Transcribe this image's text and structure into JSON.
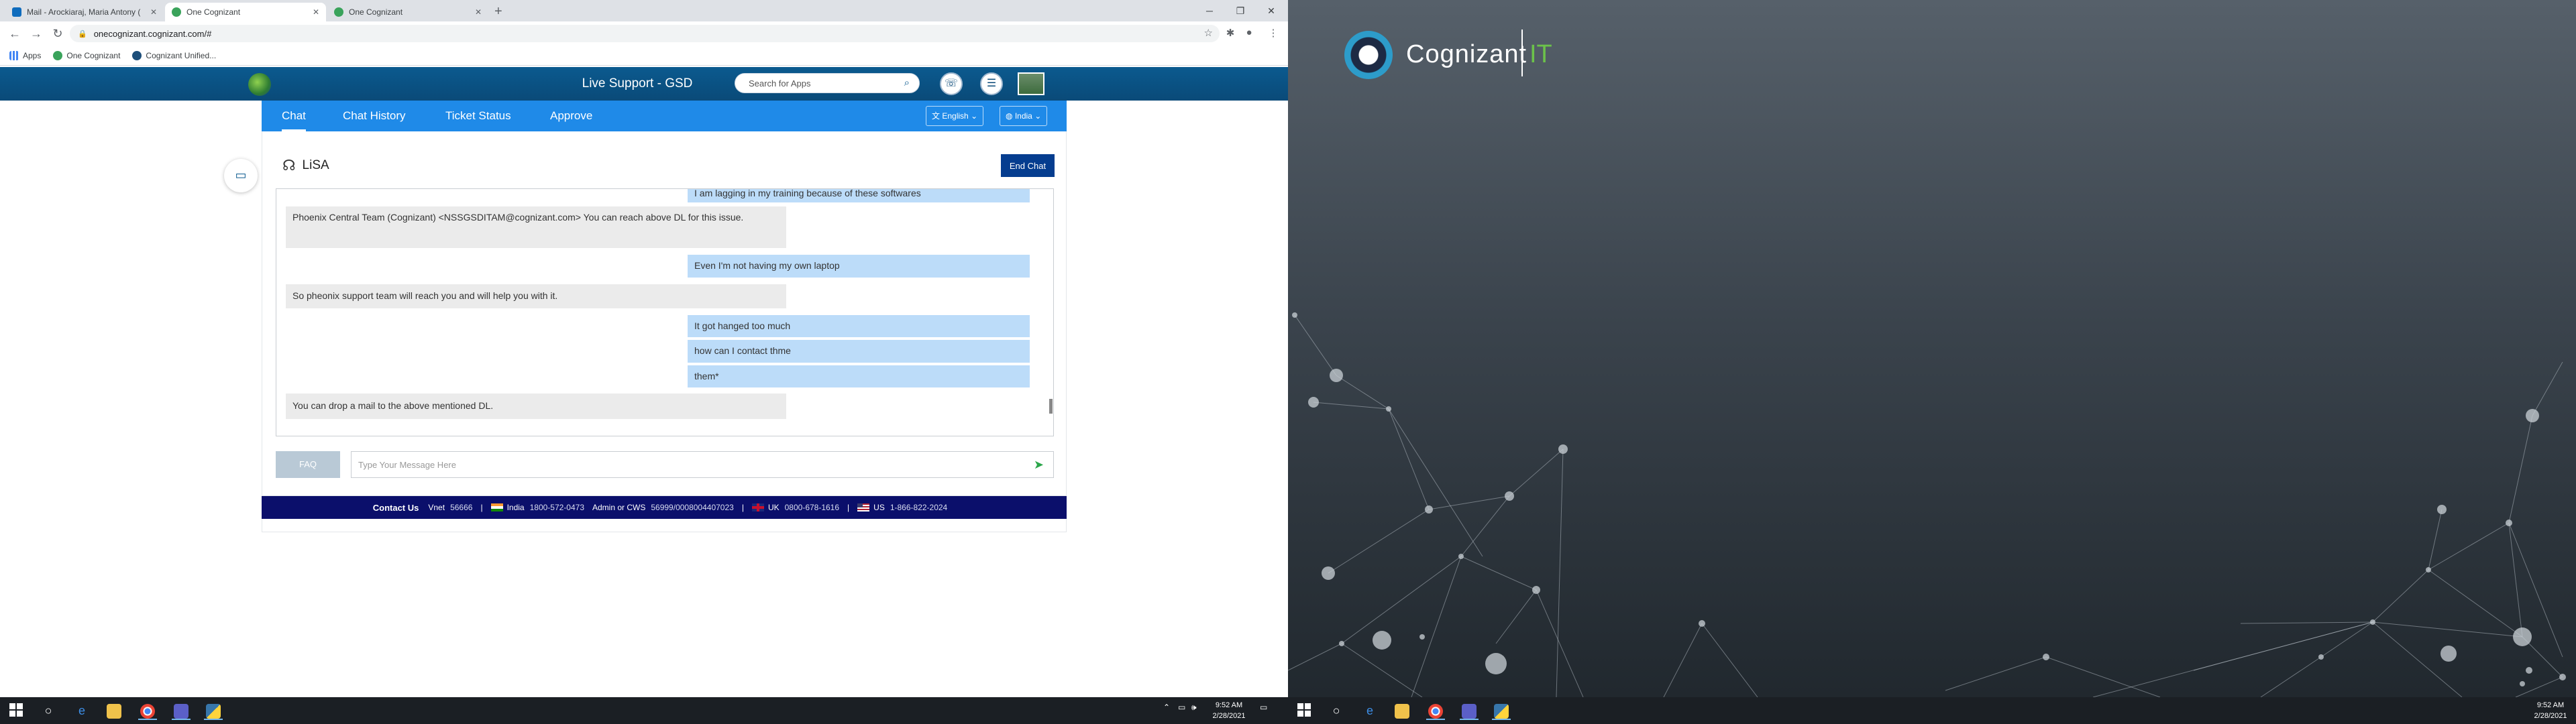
{
  "browser": {
    "tabs": [
      {
        "label": "Mail - Arockiaraj, Maria Antony (...",
        "active": false
      },
      {
        "label": "One Cognizant",
        "active": true
      },
      {
        "label": "One Cognizant",
        "active": false
      }
    ],
    "url": "onecognizant.cognizant.com/#",
    "bookmarks": [
      "Apps",
      "One Cognizant",
      "Cognizant Unified..."
    ]
  },
  "app": {
    "title": "Live Support - GSD",
    "search_placeholder": "Search for Apps",
    "nav_tabs": [
      "Chat",
      "Chat History",
      "Ticket Status",
      "Approve"
    ],
    "language": "English",
    "region": "India"
  },
  "chat": {
    "agent_name": "LiSA",
    "end_chat_label": "End Chat",
    "messages": [
      {
        "from": "user",
        "text": "I am lagging in my training because of these softwares"
      },
      {
        "from": "bot",
        "text": "Phoenix Central Team (Cognizant) <NSSGSDITAM@cognizant.com> You can reach above DL for this issue."
      },
      {
        "from": "user",
        "text": "Even I'm not having my own laptop"
      },
      {
        "from": "bot",
        "text": "So pheonix support team will reach you and will help you with it."
      },
      {
        "from": "user",
        "text": "It got hanged too much"
      },
      {
        "from": "user",
        "text": "how can I contact thme"
      },
      {
        "from": "user",
        "text": "them*"
      },
      {
        "from": "bot",
        "text": "You can drop a mail to the above mentioned DL."
      }
    ],
    "faq_label": "FAQ",
    "input_placeholder": "Type Your Message Here"
  },
  "footer": {
    "contact_label": "Contact Us",
    "vnet_label": "Vnet",
    "vnet_value": "56666",
    "india_label": "India",
    "india_value": "1800-572-0473",
    "admin_label": "Admin or CWS",
    "admin_value": "56999/0008004407023",
    "uk_label": "UK",
    "uk_value": "0800-678-1616",
    "us_label": "US",
    "us_value": "1-866-822-2024",
    "separator": "|"
  },
  "wallpaper": {
    "brand": "Cognizant",
    "suffix": "IT"
  },
  "taskbar": {
    "time": "9:52 AM",
    "date": "2/28/2021"
  },
  "colors": {
    "header_blue": "#0b5a8f",
    "nav_blue": "#1f8ae8",
    "end_chat": "#053d8f",
    "user_bubble": "#bcdcf9",
    "bot_bubble": "#ebebeb",
    "footer": "#0b0f6b",
    "brand_green": "#6cc24a"
  }
}
